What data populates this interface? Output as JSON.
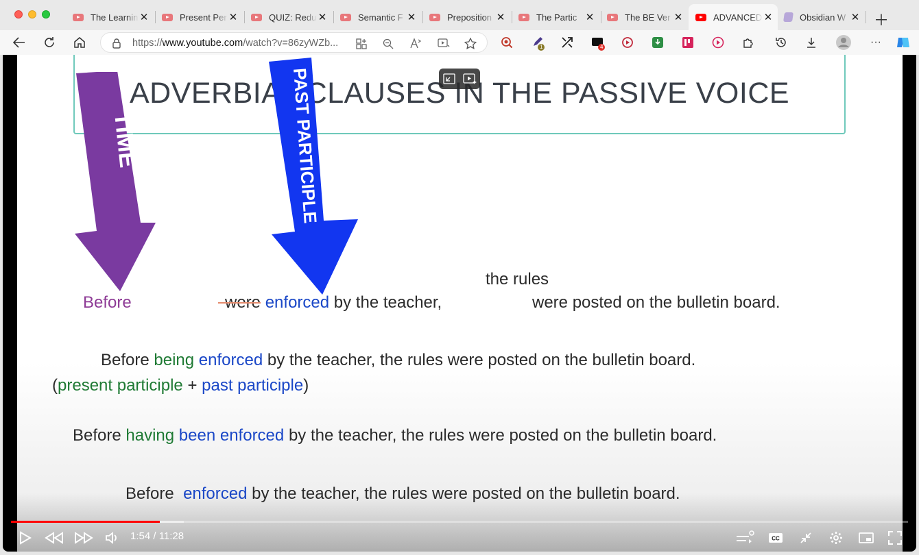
{
  "tabs": [
    {
      "title": "The Learnin"
    },
    {
      "title": "Present Per"
    },
    {
      "title": "QUIZ: Redu"
    },
    {
      "title": "Semantic F"
    },
    {
      "title": "Preposition"
    },
    {
      "title": "The Partic"
    },
    {
      "title": "The BE Ver"
    },
    {
      "title": "ADVANCED"
    },
    {
      "title": "Obsidian W"
    }
  ],
  "address": {
    "url_prefix": "https://",
    "url_domain": "www.youtube.com",
    "url_path": "/watch?v=86zyWZb..."
  },
  "extensions": {
    "badge_one": "1",
    "badge_four": "4"
  },
  "slide": {
    "title": "ADVERBIAL CLAUSES IN THE PASSIVE VOICE",
    "arrow_time": "TIME",
    "arrow_past": "PAST PARTICIPLE",
    "line1": {
      "before": "Before",
      "were": "were",
      "enforced": "enforced",
      "rest": "by the teacher,",
      "the_rules": "the rules",
      "end": "were posted on the bulletin board."
    },
    "line2": {
      "before": "Before",
      "being": "being",
      "enforced": "enforced",
      "rest": "by the teacher, the rules were posted on the bulletin board."
    },
    "note": {
      "open": "(",
      "present": "present participle",
      "plus": "+",
      "past": "past participle",
      "close": ")"
    },
    "line3": {
      "before": "Before",
      "having": "having",
      "been_enforced": "been enforced",
      "rest": "by the teacher, the rules were posted on the bulletin board."
    },
    "line4": {
      "before": "Before",
      "enforced": "enforced",
      "rest": "by the teacher, the rules were posted on the bulletin board."
    }
  },
  "player": {
    "time": "1:54 / 11:28",
    "progress_fraction": 0.166,
    "buffered_fraction": 0.193
  },
  "colors": {
    "purple_arrow": "#7a3aa0",
    "blue_arrow": "#1236f0",
    "progress": "#ff0000"
  }
}
